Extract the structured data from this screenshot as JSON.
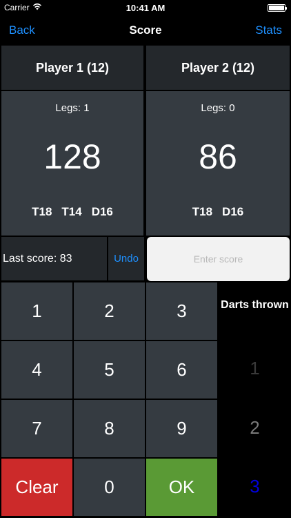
{
  "status_bar": {
    "carrier": "Carrier",
    "time": "10:41 AM"
  },
  "nav": {
    "back": "Back",
    "title": "Score",
    "stats": "Stats"
  },
  "players": [
    {
      "name": "Player 1 (12)",
      "legs": "Legs: 1",
      "score": "128",
      "checkout": [
        "T18",
        "T14",
        "D16"
      ]
    },
    {
      "name": "Player 2 (12)",
      "legs": "Legs: 0",
      "score": "86",
      "checkout": [
        "T18",
        "D16"
      ]
    }
  ],
  "last_score": "Last score: 83",
  "undo": "Undo",
  "score_input": {
    "placeholder": "Enter score",
    "value": ""
  },
  "keypad": {
    "keys": [
      "1",
      "2",
      "3",
      "4",
      "5",
      "6",
      "7",
      "8",
      "9"
    ],
    "clear": "Clear",
    "zero": "0",
    "ok": "OK"
  },
  "darts_thrown": {
    "label": "Darts thrown",
    "options": [
      "1",
      "2",
      "3"
    ],
    "selected": "3"
  },
  "colors": {
    "accent_blue": "#1e90ff",
    "clear_red": "#cc2a2a",
    "ok_green": "#5a9a35",
    "selected_dart": "#0000dd",
    "dim_dart_1": "#3a3a3a",
    "dim_dart_2": "#7a7a7a"
  }
}
